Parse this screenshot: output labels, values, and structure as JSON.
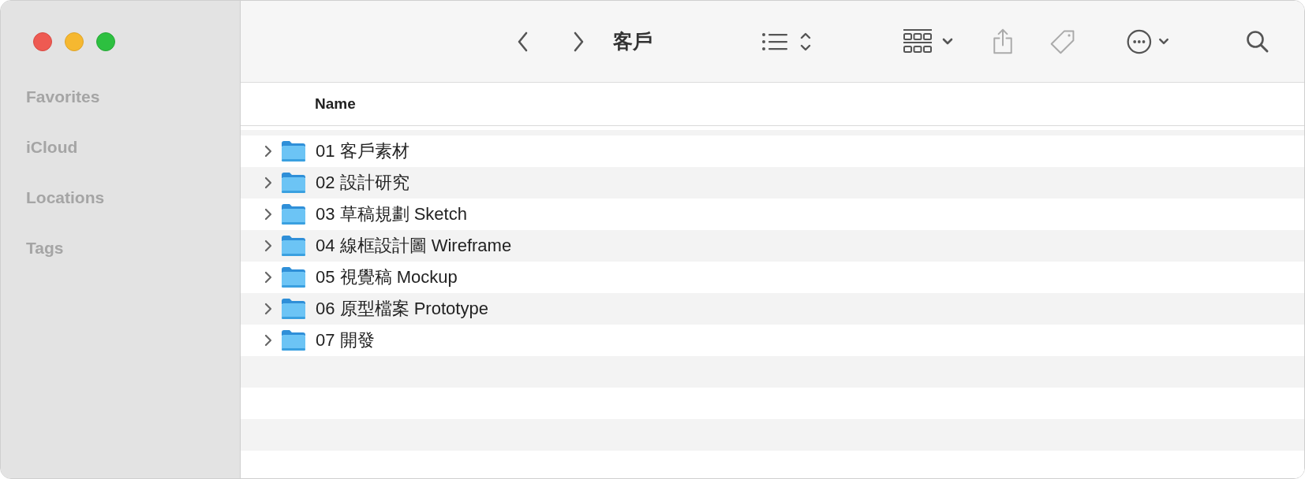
{
  "window": {
    "title": "客戶"
  },
  "sidebar": {
    "sections": [
      {
        "label": "Favorites"
      },
      {
        "label": "iCloud"
      },
      {
        "label": "Locations"
      },
      {
        "label": "Tags"
      }
    ]
  },
  "table": {
    "columns": [
      {
        "label": "Name"
      }
    ],
    "rows": [
      {
        "name": "01 客戶素材",
        "expanded": false
      },
      {
        "name": "02 設計研究",
        "expanded": false
      },
      {
        "name": "03 草稿規劃 Sketch",
        "expanded": false
      },
      {
        "name": "04 線框設計圖 Wireframe",
        "expanded": false
      },
      {
        "name": "05 視覺稿 Mockup",
        "expanded": false
      },
      {
        "name": "06 原型檔案 Prototype",
        "expanded": false
      },
      {
        "name": "07 開發",
        "expanded": false
      }
    ]
  }
}
